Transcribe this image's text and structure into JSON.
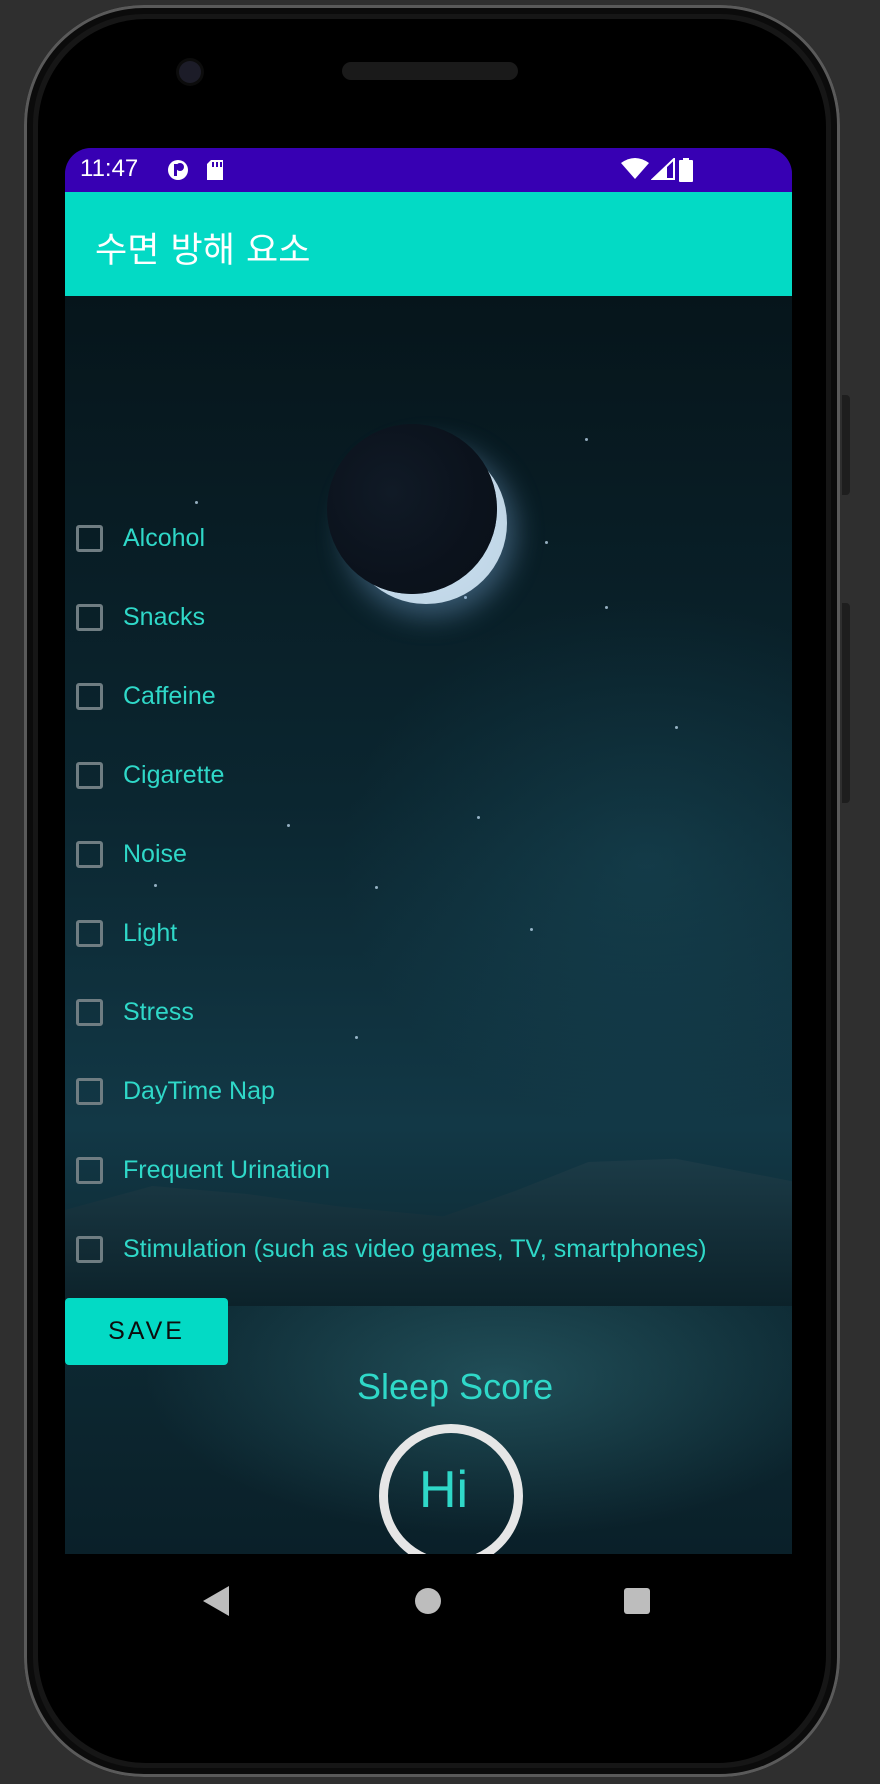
{
  "status_bar": {
    "time": "11:47",
    "icons": [
      "data-saver-icon",
      "sd-card-icon",
      "wifi-icon",
      "signal-icon",
      "battery-icon"
    ]
  },
  "app_bar": {
    "title": "수면 방해 요소"
  },
  "checklist": [
    {
      "label": "Alcohol",
      "checked": false
    },
    {
      "label": "Snacks",
      "checked": false
    },
    {
      "label": "Caffeine",
      "checked": false
    },
    {
      "label": "Cigarette",
      "checked": false
    },
    {
      "label": "Noise",
      "checked": false
    },
    {
      "label": "Light",
      "checked": false
    },
    {
      "label": "Stress",
      "checked": false
    },
    {
      "label": "DayTime Nap",
      "checked": false
    },
    {
      "label": "Frequent Urination",
      "checked": false
    },
    {
      "label": "Stimulation (such as video games, TV, smartphones)",
      "checked": false
    }
  ],
  "save_button": {
    "label": "SAVE"
  },
  "score": {
    "title": "Sleep Score",
    "value": "Hi"
  },
  "nav": {
    "icons": [
      "back-icon",
      "home-icon",
      "recents-icon"
    ]
  },
  "colors": {
    "status_bar": "#3700b3",
    "accent": "#03dac5",
    "text_accent": "#2fd8c8"
  }
}
